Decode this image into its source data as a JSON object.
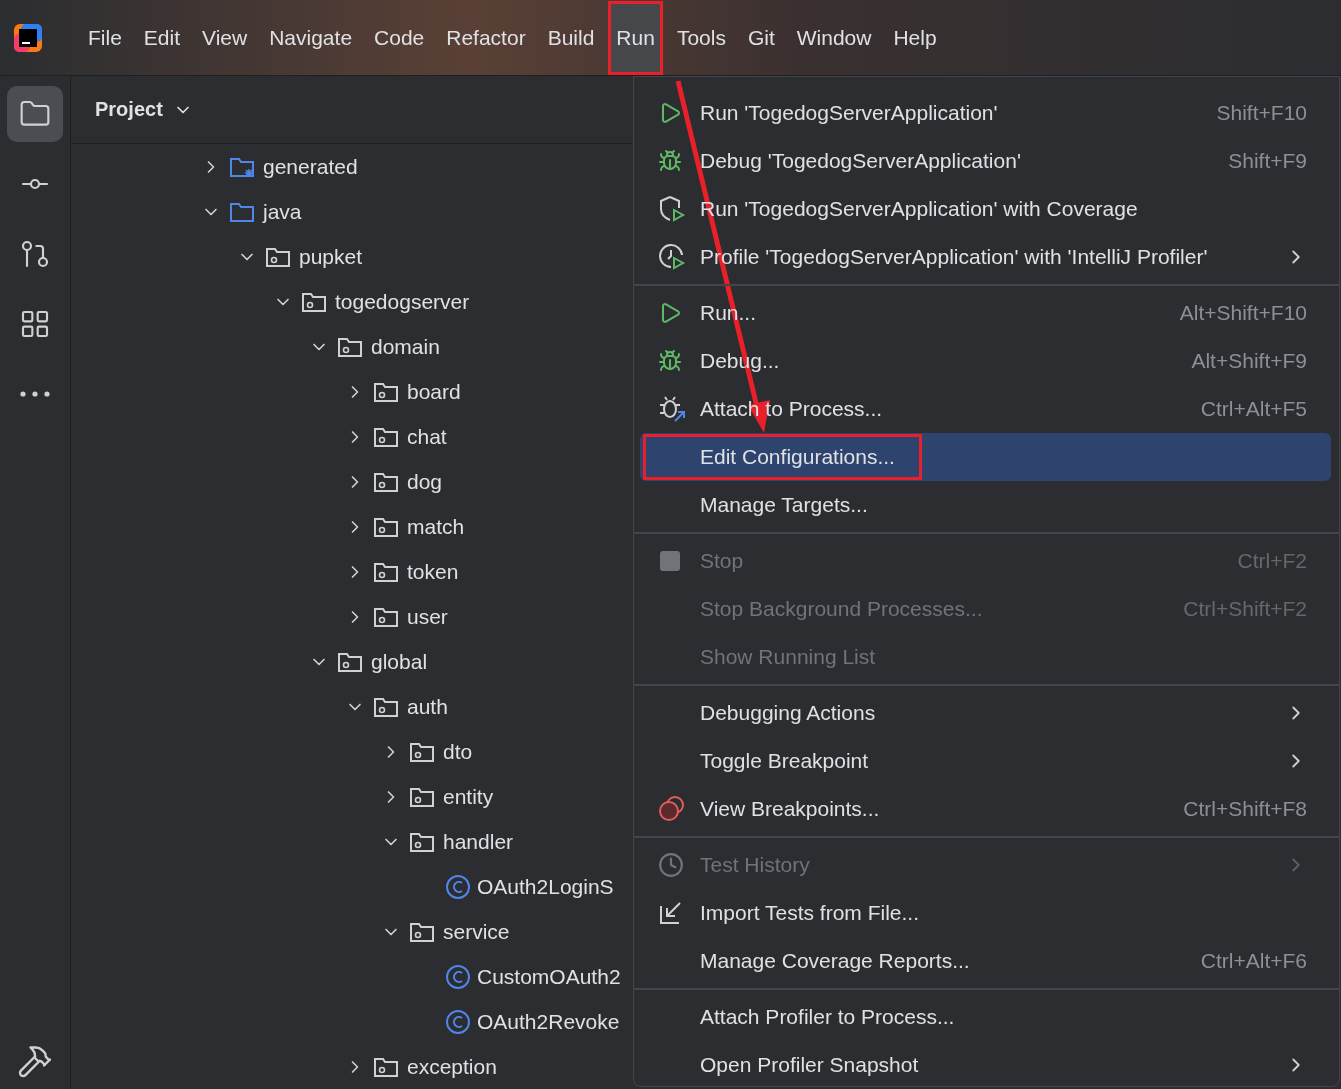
{
  "menu_bar": [
    {
      "label": "File",
      "selected": false
    },
    {
      "label": "Edit",
      "selected": false
    },
    {
      "label": "View",
      "selected": false
    },
    {
      "label": "Navigate",
      "selected": false
    },
    {
      "label": "Code",
      "selected": false
    },
    {
      "label": "Refactor",
      "selected": false
    },
    {
      "label": "Build",
      "selected": false
    },
    {
      "label": "Run",
      "selected": true,
      "annotated": true
    },
    {
      "label": "Tools",
      "selected": false
    },
    {
      "label": "Git",
      "selected": false
    },
    {
      "label": "Window",
      "selected": false
    },
    {
      "label": "Help",
      "selected": false
    }
  ],
  "tool_strip": [
    {
      "kind": "folder",
      "selected": true
    },
    {
      "kind": "commit",
      "selected": false
    },
    {
      "kind": "pull",
      "selected": false
    },
    {
      "kind": "structure",
      "selected": false
    },
    {
      "kind": "more",
      "selected": false
    }
  ],
  "project_panel": {
    "title": "Project",
    "tree": [
      {
        "label": "generated",
        "kind": "generated",
        "expanded": false
      },
      {
        "label": "java",
        "kind": "folder",
        "expanded": true,
        "children": [
          {
            "label": "pupket",
            "kind": "package",
            "expanded": true,
            "children": [
              {
                "label": "togedogserver",
                "kind": "package",
                "expanded": true,
                "children": [
                  {
                    "label": "domain",
                    "kind": "package",
                    "expanded": true,
                    "children": [
                      {
                        "label": "board",
                        "kind": "package",
                        "expanded": false
                      },
                      {
                        "label": "chat",
                        "kind": "package",
                        "expanded": false
                      },
                      {
                        "label": "dog",
                        "kind": "package",
                        "expanded": false
                      },
                      {
                        "label": "match",
                        "kind": "package",
                        "expanded": false
                      },
                      {
                        "label": "token",
                        "kind": "package",
                        "expanded": false
                      },
                      {
                        "label": "user",
                        "kind": "package",
                        "expanded": false
                      }
                    ]
                  },
                  {
                    "label": "global",
                    "kind": "package",
                    "expanded": true,
                    "children": [
                      {
                        "label": "auth",
                        "kind": "package",
                        "expanded": true,
                        "children": [
                          {
                            "label": "dto",
                            "kind": "package",
                            "expanded": false
                          },
                          {
                            "label": "entity",
                            "kind": "package",
                            "expanded": false
                          },
                          {
                            "label": "handler",
                            "kind": "package",
                            "expanded": true,
                            "children": [
                              {
                                "label": "OAuth2LoginS",
                                "kind": "class"
                              }
                            ]
                          },
                          {
                            "label": "service",
                            "kind": "package",
                            "expanded": true,
                            "children": [
                              {
                                "label": "CustomOAuth2",
                                "kind": "class"
                              },
                              {
                                "label": "OAuth2Revoke",
                                "kind": "class"
                              }
                            ]
                          }
                        ]
                      },
                      {
                        "label": "exception",
                        "kind": "package",
                        "expanded": false
                      }
                    ]
                  }
                ]
              }
            ]
          }
        ]
      }
    ]
  },
  "run_menu": [
    [
      {
        "label": "Run 'TogedogServerApplication'",
        "kind": "run",
        "shortcut": "Shift+F10",
        "disabled": false,
        "selected": false
      },
      {
        "label": "Debug 'TogedogServerApplication'",
        "kind": "debug",
        "shortcut": "Shift+F9",
        "disabled": false,
        "selected": false
      },
      {
        "label": "Run 'TogedogServerApplication' with Coverage",
        "kind": "coverage",
        "disabled": false,
        "selected": false
      },
      {
        "label": "Profile 'TogedogServerApplication' with 'IntelliJ Profiler'",
        "kind": "profile",
        "submenu": true,
        "disabled": false,
        "selected": false
      }
    ],
    [
      {
        "label": "Run...",
        "kind": "run",
        "shortcut": "Alt+Shift+F10",
        "disabled": false,
        "selected": false
      },
      {
        "label": "Debug...",
        "kind": "debug",
        "shortcut": "Alt+Shift+F9",
        "disabled": false,
        "selected": false
      },
      {
        "label": "Attach to Process...",
        "kind": "attach",
        "shortcut": "Ctrl+Alt+F5",
        "disabled": false,
        "selected": false
      },
      {
        "label": "Edit Configurations...",
        "kind": "plain",
        "disabled": false,
        "selected": true,
        "annotated": true
      },
      {
        "label": "Manage Targets...",
        "kind": "plain",
        "disabled": false,
        "selected": false
      }
    ],
    [
      {
        "label": "Stop",
        "kind": "stop",
        "shortcut": "Ctrl+F2",
        "disabled": true,
        "selected": false
      },
      {
        "label": "Stop Background Processes...",
        "kind": "plain",
        "shortcut": "Ctrl+Shift+F2",
        "disabled": true,
        "selected": false
      },
      {
        "label": "Show Running List",
        "kind": "plain",
        "disabled": true,
        "selected": false
      }
    ],
    [
      {
        "label": "Debugging Actions",
        "kind": "plain",
        "submenu": true,
        "disabled": false,
        "selected": false
      },
      {
        "label": "Toggle Breakpoint",
        "kind": "plain",
        "submenu": true,
        "disabled": false,
        "selected": false
      },
      {
        "label": "View Breakpoints...",
        "kind": "breakpoints",
        "shortcut": "Ctrl+Shift+F8",
        "disabled": false,
        "selected": false
      }
    ],
    [
      {
        "label": "Test History",
        "kind": "history",
        "submenu": true,
        "disabled": true,
        "selected": false
      },
      {
        "label": "Import Tests from File...",
        "kind": "import",
        "disabled": false,
        "selected": false
      },
      {
        "label": "Manage Coverage Reports...",
        "kind": "plain",
        "shortcut": "Ctrl+Alt+F6",
        "disabled": false,
        "selected": false
      }
    ],
    [
      {
        "label": "Attach Profiler to Process...",
        "kind": "plain",
        "disabled": false,
        "selected": false
      },
      {
        "label": "Open Profiler Snapshot",
        "kind": "plain",
        "submenu": true,
        "disabled": false,
        "selected": false
      }
    ]
  ]
}
